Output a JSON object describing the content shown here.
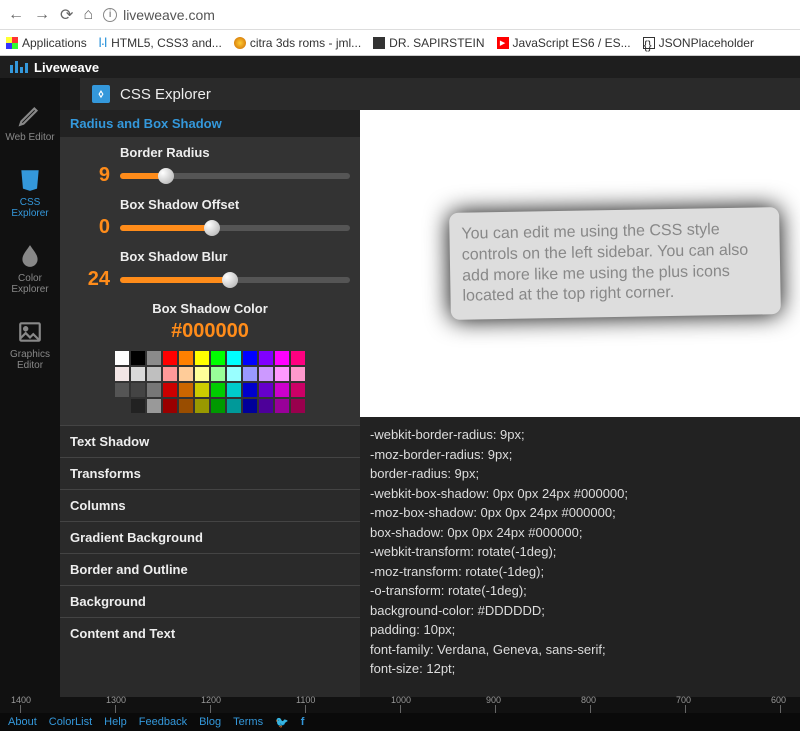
{
  "browser": {
    "address": "liveweave.com",
    "bookmarks": [
      {
        "label": "Applications"
      },
      {
        "label": "HTML5, CSS3 and..."
      },
      {
        "label": "citra 3ds roms - jml..."
      },
      {
        "label": "DR. SAPIRSTEIN"
      },
      {
        "label": "JavaScript ES6 / ES..."
      },
      {
        "label": "JSONPlaceholder"
      }
    ]
  },
  "app": {
    "name": "Liveweave"
  },
  "panel": {
    "title": "CSS Explorer"
  },
  "vsidebar": {
    "items": [
      {
        "label": "Web Editor"
      },
      {
        "label": "CSS Explorer"
      },
      {
        "label": "Color Explorer"
      },
      {
        "label": "Graphics Editor"
      }
    ]
  },
  "controls": {
    "section_title": "Radius and Box Shadow",
    "sliders": [
      {
        "label": "Border Radius",
        "value": "9",
        "pct": 20
      },
      {
        "label": "Box Shadow Offset",
        "value": "0",
        "pct": 40
      },
      {
        "label": "Box Shadow Blur",
        "value": "24",
        "pct": 48
      }
    ],
    "color": {
      "label": "Box Shadow Color",
      "value": "#000000"
    },
    "swatches": [
      "#ffffff",
      "#000000",
      "#8b8b8b",
      "#ff0000",
      "#ff8000",
      "#ffff00",
      "#00ff00",
      "#00ffff",
      "#0000ff",
      "#8000ff",
      "#ff00ff",
      "#ff0080",
      "#f2e6e6",
      "#d9d9d9",
      "#bfbfbf",
      "#ff9999",
      "#ffcc99",
      "#ffff99",
      "#99ff99",
      "#99ffff",
      "#9999ff",
      "#cc99ff",
      "#ff99ff",
      "#ff99cc",
      "#555555",
      "#444444",
      "#777777",
      "#cc0000",
      "#cc6600",
      "#cccc00",
      "#00cc00",
      "#00cccc",
      "#0000cc",
      "#6600cc",
      "#cc00cc",
      "#cc0066",
      "#333333",
      "#222222",
      "#999999",
      "#990000",
      "#994d00",
      "#999900",
      "#009900",
      "#009999",
      "#000099",
      "#4d0099",
      "#990099",
      "#99004d"
    ],
    "other_sections": [
      "Text Shadow",
      "Transforms",
      "Columns",
      "Gradient Background",
      "Border and Outline",
      "Background",
      "Content and Text"
    ]
  },
  "preview": {
    "text": "You can edit me using the CSS style controls on the left sidebar. You can also add more like me using the plus icons located at the top right corner."
  },
  "code": {
    "lines": [
      "-webkit-border-radius: 9px;",
      "-moz-border-radius: 9px;",
      "border-radius: 9px;",
      "-webkit-box-shadow: 0px 0px 24px #000000;",
      "-moz-box-shadow: 0px 0px 24px #000000;",
      "box-shadow: 0px 0px 24px #000000;",
      "-webkit-transform: rotate(-1deg);",
      "-moz-transform: rotate(-1deg);",
      "-o-transform: rotate(-1deg);",
      "background-color: #DDDDDD;",
      "padding: 10px;",
      "font-family: Verdana, Geneva, sans-serif;",
      "font-size: 12pt;"
    ]
  },
  "ruler": {
    "labels": [
      "1400",
      "1300",
      "1200",
      "1100",
      "1000",
      "900",
      "800",
      "700",
      "600"
    ]
  },
  "footer": {
    "links": [
      "About",
      "ColorList",
      "Help",
      "Feedback",
      "Blog",
      "Terms"
    ]
  }
}
